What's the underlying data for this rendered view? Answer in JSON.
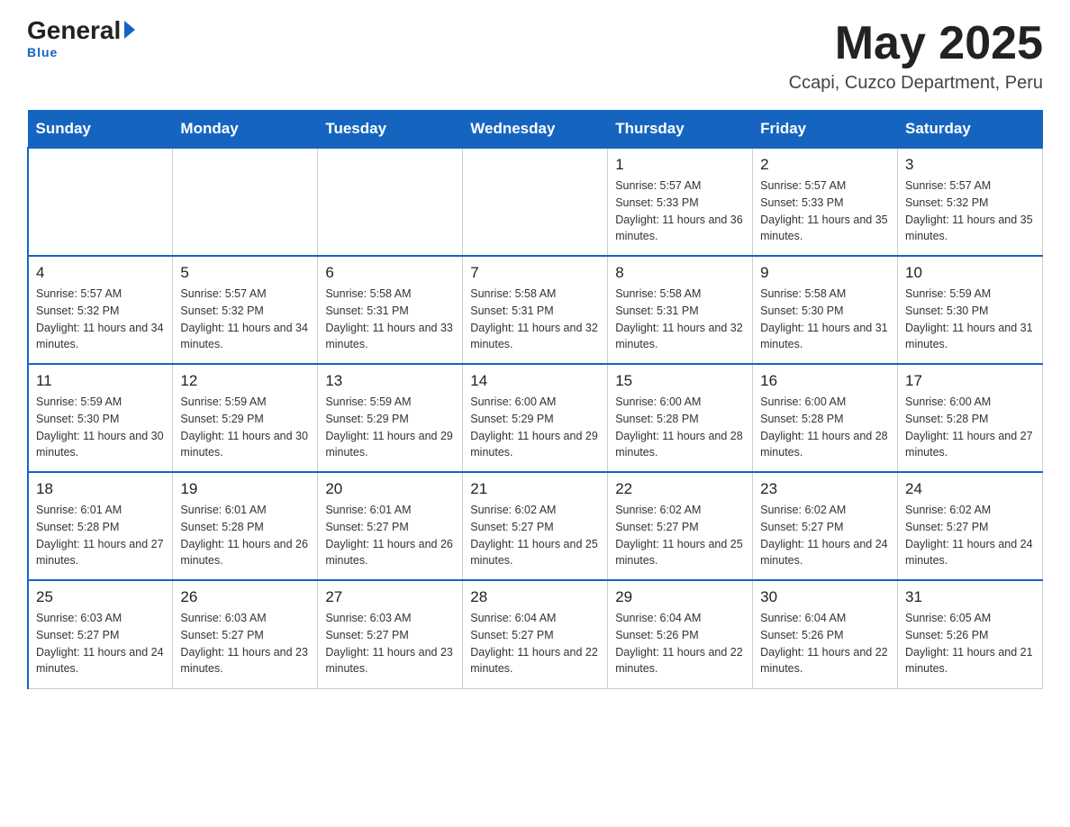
{
  "header": {
    "logo_general": "General",
    "logo_blue": "Blue",
    "month_title": "May 2025",
    "location": "Ccapi, Cuzco Department, Peru"
  },
  "days_of_week": [
    "Sunday",
    "Monday",
    "Tuesday",
    "Wednesday",
    "Thursday",
    "Friday",
    "Saturday"
  ],
  "weeks": [
    [
      {
        "day": "",
        "info": ""
      },
      {
        "day": "",
        "info": ""
      },
      {
        "day": "",
        "info": ""
      },
      {
        "day": "",
        "info": ""
      },
      {
        "day": "1",
        "info": "Sunrise: 5:57 AM\nSunset: 5:33 PM\nDaylight: 11 hours and 36 minutes."
      },
      {
        "day": "2",
        "info": "Sunrise: 5:57 AM\nSunset: 5:33 PM\nDaylight: 11 hours and 35 minutes."
      },
      {
        "day": "3",
        "info": "Sunrise: 5:57 AM\nSunset: 5:32 PM\nDaylight: 11 hours and 35 minutes."
      }
    ],
    [
      {
        "day": "4",
        "info": "Sunrise: 5:57 AM\nSunset: 5:32 PM\nDaylight: 11 hours and 34 minutes."
      },
      {
        "day": "5",
        "info": "Sunrise: 5:57 AM\nSunset: 5:32 PM\nDaylight: 11 hours and 34 minutes."
      },
      {
        "day": "6",
        "info": "Sunrise: 5:58 AM\nSunset: 5:31 PM\nDaylight: 11 hours and 33 minutes."
      },
      {
        "day": "7",
        "info": "Sunrise: 5:58 AM\nSunset: 5:31 PM\nDaylight: 11 hours and 32 minutes."
      },
      {
        "day": "8",
        "info": "Sunrise: 5:58 AM\nSunset: 5:31 PM\nDaylight: 11 hours and 32 minutes."
      },
      {
        "day": "9",
        "info": "Sunrise: 5:58 AM\nSunset: 5:30 PM\nDaylight: 11 hours and 31 minutes."
      },
      {
        "day": "10",
        "info": "Sunrise: 5:59 AM\nSunset: 5:30 PM\nDaylight: 11 hours and 31 minutes."
      }
    ],
    [
      {
        "day": "11",
        "info": "Sunrise: 5:59 AM\nSunset: 5:30 PM\nDaylight: 11 hours and 30 minutes."
      },
      {
        "day": "12",
        "info": "Sunrise: 5:59 AM\nSunset: 5:29 PM\nDaylight: 11 hours and 30 minutes."
      },
      {
        "day": "13",
        "info": "Sunrise: 5:59 AM\nSunset: 5:29 PM\nDaylight: 11 hours and 29 minutes."
      },
      {
        "day": "14",
        "info": "Sunrise: 6:00 AM\nSunset: 5:29 PM\nDaylight: 11 hours and 29 minutes."
      },
      {
        "day": "15",
        "info": "Sunrise: 6:00 AM\nSunset: 5:28 PM\nDaylight: 11 hours and 28 minutes."
      },
      {
        "day": "16",
        "info": "Sunrise: 6:00 AM\nSunset: 5:28 PM\nDaylight: 11 hours and 28 minutes."
      },
      {
        "day": "17",
        "info": "Sunrise: 6:00 AM\nSunset: 5:28 PM\nDaylight: 11 hours and 27 minutes."
      }
    ],
    [
      {
        "day": "18",
        "info": "Sunrise: 6:01 AM\nSunset: 5:28 PM\nDaylight: 11 hours and 27 minutes."
      },
      {
        "day": "19",
        "info": "Sunrise: 6:01 AM\nSunset: 5:28 PM\nDaylight: 11 hours and 26 minutes."
      },
      {
        "day": "20",
        "info": "Sunrise: 6:01 AM\nSunset: 5:27 PM\nDaylight: 11 hours and 26 minutes."
      },
      {
        "day": "21",
        "info": "Sunrise: 6:02 AM\nSunset: 5:27 PM\nDaylight: 11 hours and 25 minutes."
      },
      {
        "day": "22",
        "info": "Sunrise: 6:02 AM\nSunset: 5:27 PM\nDaylight: 11 hours and 25 minutes."
      },
      {
        "day": "23",
        "info": "Sunrise: 6:02 AM\nSunset: 5:27 PM\nDaylight: 11 hours and 24 minutes."
      },
      {
        "day": "24",
        "info": "Sunrise: 6:02 AM\nSunset: 5:27 PM\nDaylight: 11 hours and 24 minutes."
      }
    ],
    [
      {
        "day": "25",
        "info": "Sunrise: 6:03 AM\nSunset: 5:27 PM\nDaylight: 11 hours and 24 minutes."
      },
      {
        "day": "26",
        "info": "Sunrise: 6:03 AM\nSunset: 5:27 PM\nDaylight: 11 hours and 23 minutes."
      },
      {
        "day": "27",
        "info": "Sunrise: 6:03 AM\nSunset: 5:27 PM\nDaylight: 11 hours and 23 minutes."
      },
      {
        "day": "28",
        "info": "Sunrise: 6:04 AM\nSunset: 5:27 PM\nDaylight: 11 hours and 22 minutes."
      },
      {
        "day": "29",
        "info": "Sunrise: 6:04 AM\nSunset: 5:26 PM\nDaylight: 11 hours and 22 minutes."
      },
      {
        "day": "30",
        "info": "Sunrise: 6:04 AM\nSunset: 5:26 PM\nDaylight: 11 hours and 22 minutes."
      },
      {
        "day": "31",
        "info": "Sunrise: 6:05 AM\nSunset: 5:26 PM\nDaylight: 11 hours and 21 minutes."
      }
    ]
  ]
}
